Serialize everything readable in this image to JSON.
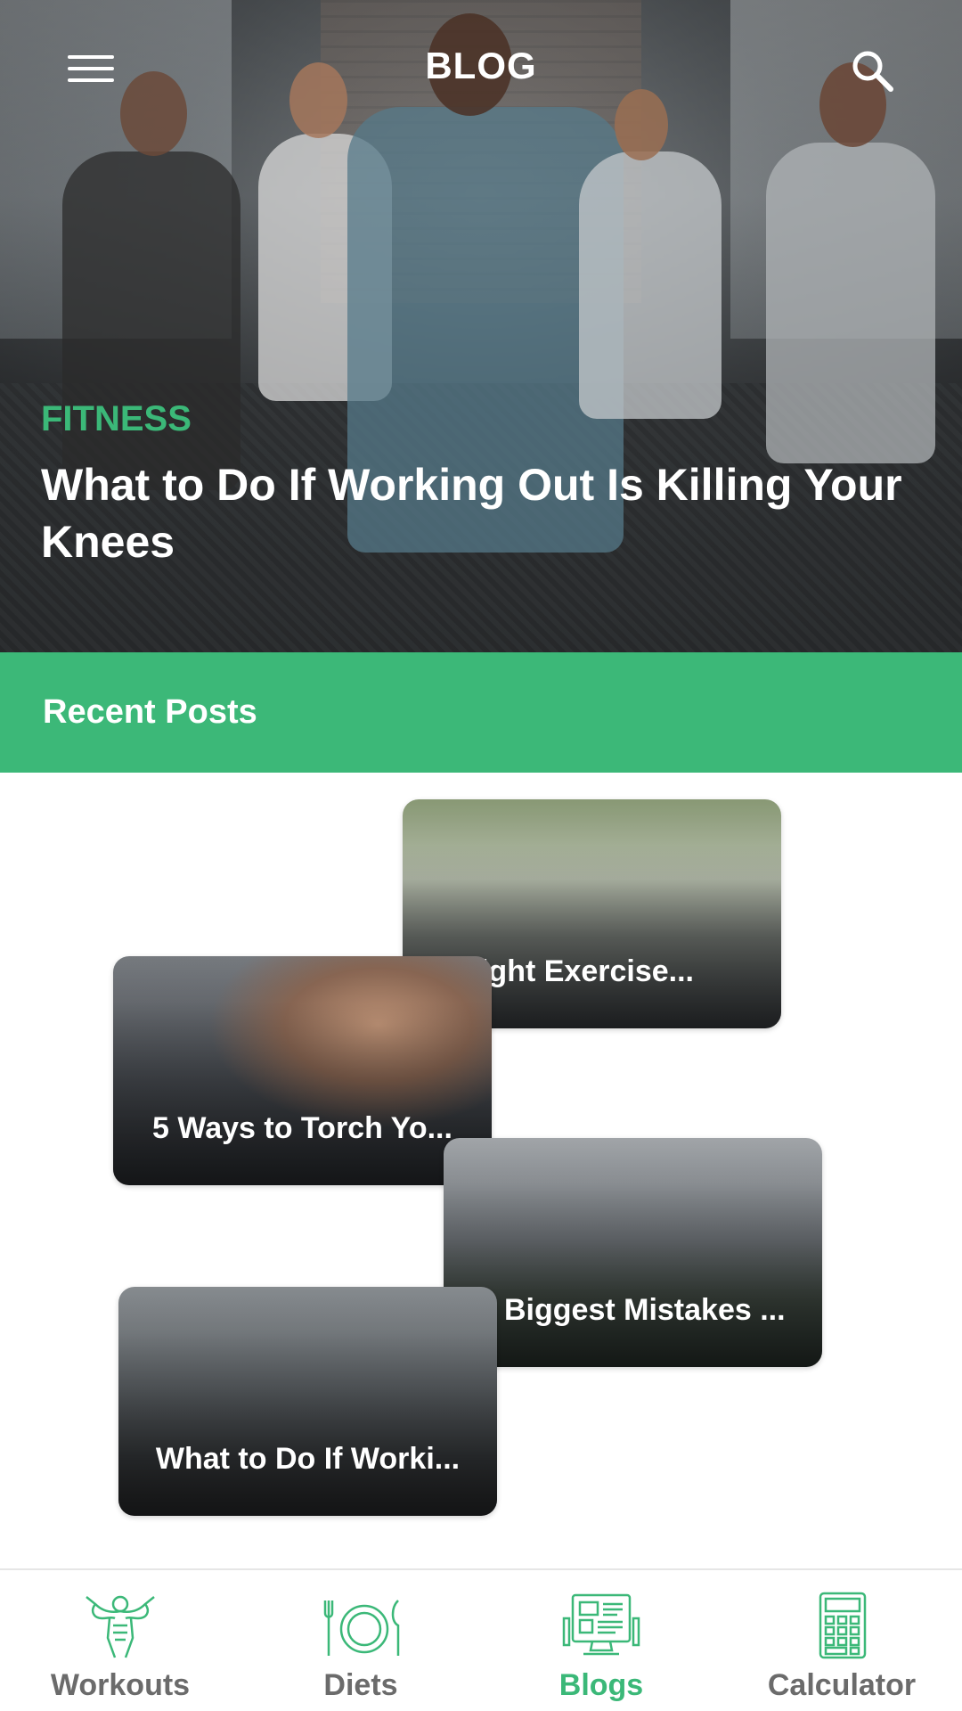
{
  "header": {
    "title": "BLOG",
    "menu_icon": "hamburger-menu-icon",
    "search_icon": "search-icon"
  },
  "featured": {
    "category": "FITNESS",
    "title": "What to Do If Working Out Is Killing Your Knees"
  },
  "recent": {
    "heading": "Recent Posts",
    "posts": [
      {
        "title": "n Light Exercise..."
      },
      {
        "title": "5 Ways to Torch Yo..."
      },
      {
        "title": "Biggest Mistakes ..."
      },
      {
        "title": "What to Do If Worki..."
      }
    ]
  },
  "nav": {
    "items": [
      {
        "label": "Workouts",
        "icon": "bodybuilder-icon"
      },
      {
        "label": "Diets",
        "icon": "plate-cutlery-icon"
      },
      {
        "label": "Blogs",
        "icon": "blog-monitor-icon",
        "active": true
      },
      {
        "label": "Calculator",
        "icon": "calculator-icon"
      }
    ]
  },
  "colors": {
    "accent": "#3cb878",
    "nav_inactive": "#6b6b6b",
    "icon_green": "#3bb878"
  }
}
